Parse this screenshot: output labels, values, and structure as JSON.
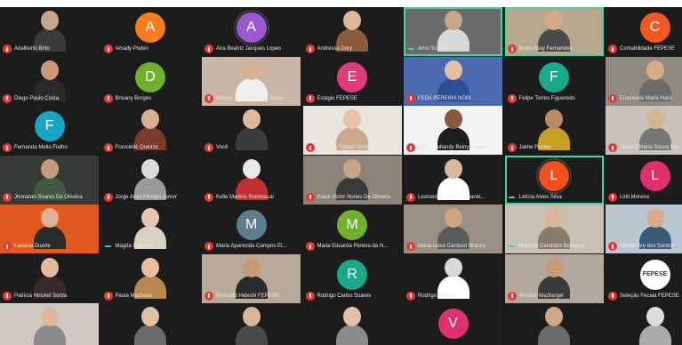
{
  "participants": [
    {
      "name": "Adalberto Brito",
      "kind": "video",
      "bg": "#1c1c1c",
      "skin": "#c8a48a",
      "shirt": "#3a3a3a",
      "mic": "muted"
    },
    {
      "name": "Amady Platen",
      "kind": "avatar",
      "initial": "A",
      "color": "#f57c1f",
      "mic": "muted"
    },
    {
      "name": "Ana Beatriz Jacques Lopes",
      "kind": "avatar",
      "initial": "A",
      "color": "#9b59d0",
      "mic": "muted",
      "ring": true
    },
    {
      "name": "Andressa Dary",
      "kind": "video",
      "bg": "#1c1c1c",
      "skin": "#e0b59a",
      "shirt": "#8a5a3a",
      "mic": "muted"
    },
    {
      "name": "Arno Schmitt",
      "kind": "video",
      "bg": "#6b6b6b",
      "skin": "#c9a58a",
      "shirt": "#d8d8d8",
      "mic": "on",
      "speaking": true
    },
    {
      "name": "Bruno Klay Fernandes",
      "kind": "video",
      "bg": "#b8a78f",
      "skin": "#d3a98a",
      "shirt": "#4a4a4a",
      "mic": "muted",
      "speaking": true
    },
    {
      "name": "Contabilidade FEPESE",
      "kind": "avatar",
      "initial": "C",
      "color": "#f2581f",
      "mic": "muted"
    },
    {
      "name": "Diego Paulo Costa",
      "kind": "video",
      "bg": "#1c1c1c",
      "skin": "#c89a7a",
      "shirt": "#2a2a2a",
      "mic": "muted"
    },
    {
      "name": "Brivany Borges",
      "kind": "avatar",
      "initial": "D",
      "color": "#6fb12c",
      "mic": "muted"
    },
    {
      "name": "Edlene Nunes Santos Souto",
      "kind": "video",
      "bg": "#c7b5a5",
      "skin": "#d8b094",
      "shirt": "#f0f0f0",
      "mic": "muted"
    },
    {
      "name": "Estagio FEPESE",
      "kind": "avatar",
      "initial": "E",
      "color": "#e33a7a",
      "mic": "muted"
    },
    {
      "name": "FEDA PEREIRA NÓBI",
      "kind": "video",
      "bg": "#4a6bb0",
      "skin": "#e3c0a3",
      "shirt": "#2d4f96",
      "mic": "muted"
    },
    {
      "name": "Felipe Torres Figueredo",
      "kind": "avatar",
      "initial": "F",
      "color": "#18a98b",
      "mic": "muted"
    },
    {
      "name": "Emanuela Maria Hans",
      "kind": "video",
      "bg": "#8f8a82",
      "skin": "#d6ab8c",
      "shirt": "#6d6d6d",
      "mic": "muted"
    },
    {
      "name": "Fernanda Mello Fialho",
      "kind": "avatar",
      "initial": "F",
      "color": "#1aa5c6",
      "mic": "muted"
    },
    {
      "name": "Franciélle Queiroz",
      "kind": "video",
      "bg": "#1c1c1c",
      "skin": "#d9b08f",
      "shirt": "#7a3b2b",
      "mic": "muted"
    },
    {
      "name": "Você",
      "kind": "video",
      "bg": "#1c1c1c",
      "skin": "#e0b99d",
      "shirt": "#3b3b3b",
      "mic": "muted"
    },
    {
      "name": "Gabriela Tagliari Martins",
      "kind": "video",
      "bg": "#e8e4de",
      "skin": "#e7c4a8",
      "shirt": "#c9a88c",
      "mic": "muted"
    },
    {
      "name": "Gleisy Tullandy Beiny Cordei...",
      "kind": "video",
      "bg": "#f3f3f3",
      "skin": "#8a5a3c",
      "shirt": "#1e1e1e",
      "mic": "muted"
    },
    {
      "name": "Jaime Pozian",
      "kind": "video",
      "bg": "#1c1c1c",
      "skin": "#b98a66",
      "shirt": "#c8a020",
      "mic": "muted"
    },
    {
      "name": "Jessica Maria Sousa Ro...",
      "kind": "video",
      "bg": "#c8c2ba",
      "skin": "#d8b092",
      "shirt": "#777777",
      "mic": "muted"
    },
    {
      "name": "Jhonatan Soares De Oliveira",
      "kind": "video",
      "bg": "#343a36",
      "skin": "#c59a7a",
      "shirt": "#3f5a3f",
      "mic": "muted"
    },
    {
      "name": "Jorge Aires Floriani Junior",
      "kind": "video",
      "bg": "#1c1c1c",
      "skin": "#d9dcdc",
      "shirt": "#9a9a9a",
      "mic": "muted"
    },
    {
      "name": "Kelle Martins Sommacal",
      "kind": "video",
      "bg": "#1c1c1c",
      "skin": "#e8e8e8",
      "shirt": "#c03030",
      "mic": "muted"
    },
    {
      "name": "Klaus Victor Nunes De Oliveira",
      "kind": "video",
      "bg": "#8c8478",
      "skin": "#c9a385",
      "shirt": "#3a3a3a",
      "mic": "muted"
    },
    {
      "name": "Leonardo Augusto Amante...",
      "kind": "video",
      "bg": "#1c1c1c",
      "skin": "#d7b89d",
      "shirt": "#ffffff",
      "mic": "muted"
    },
    {
      "name": "Letícia Alves Silva",
      "kind": "avatar",
      "initial": "L",
      "color": "#f2501e",
      "mic": "on",
      "speaking": true,
      "ring": true
    },
    {
      "name": "Liriti Moreira",
      "kind": "avatar",
      "initial": "L",
      "color": "#e0306f",
      "mic": "muted"
    },
    {
      "name": "Luciana Duarte",
      "kind": "video",
      "bg": "#e05a20",
      "skin": "#e0b094",
      "shirt": "#2a2a2a",
      "mic": "muted"
    },
    {
      "name": "Magda Degraaff",
      "kind": "video",
      "bg": "#1c1c1c",
      "skin": "#e6c6ad",
      "shirt": "#d9d0c2",
      "mic": "on"
    },
    {
      "name": "Maria Aparecida Campos El...",
      "kind": "avatar",
      "initial": "M",
      "color": "#607d8b",
      "mic": "muted"
    },
    {
      "name": "Maria Eduarda Pereira da N...",
      "kind": "avatar",
      "initial": "M",
      "color": "#6fb12c",
      "mic": "muted"
    },
    {
      "name": "Maria Luisa Cardoso Branco",
      "kind": "video",
      "bg": "#9a8f83",
      "skin": "#d3a384",
      "shirt": "#5a5a5a",
      "mic": "muted"
    },
    {
      "name": "Mariana Candolini Bonassa",
      "kind": "video",
      "bg": "#c9c0b4",
      "skin": "#dcb498",
      "shirt": "#8a7a6a",
      "mic": "on"
    },
    {
      "name": "Natalia Ary dos Santos",
      "kind": "video",
      "bg": "#b8c7d0",
      "skin": "#d8ab8d",
      "shirt": "#3a5a7a",
      "mic": "muted"
    },
    {
      "name": "Patricia Hinckel Sorda",
      "kind": "video",
      "bg": "#1c1c1c",
      "skin": "#e2b89c",
      "shirt": "#3a2a2a",
      "mic": "muted"
    },
    {
      "name": "Paula Machado",
      "kind": "video",
      "bg": "#1c1c1c",
      "skin": "#e6bf9e",
      "shirt": "#b8864e",
      "mic": "muted"
    },
    {
      "name": "Reinaldo Hideshi FEPESE",
      "kind": "video",
      "bg": "#b8aa98",
      "skin": "#c99876",
      "shirt": "#2a2a2a",
      "mic": "muted"
    },
    {
      "name": "Rodrigo Carlos Soares",
      "kind": "avatar",
      "initial": "R",
      "color": "#18a98b",
      "mic": "muted"
    },
    {
      "name": "Rodrigo Wilbert",
      "kind": "video",
      "bg": "#1c1c1c",
      "skin": "#d9d9d9",
      "shirt": "#ffffff",
      "mic": "muted"
    },
    {
      "name": "Simone Waztlargel",
      "kind": "video",
      "bg": "#b3a89b",
      "skin": "#c79a78",
      "shirt": "#3a3a3a",
      "mic": "muted"
    },
    {
      "name": "Seleção Fecaia FEPESE",
      "kind": "logo",
      "logo": "FEPESE",
      "color": "#ffffff",
      "mic": "muted"
    },
    {
      "name": "",
      "kind": "video",
      "bg": "#cfc9c1",
      "skin": "#e0b598",
      "shirt": "#8a8a8a",
      "mic": "none"
    },
    {
      "name": "",
      "kind": "video",
      "bg": "#1c1c1c",
      "skin": "#e2bea2",
      "shirt": "#6a6a6a",
      "mic": "none"
    },
    {
      "name": "",
      "kind": "video",
      "bg": "#1c1c1c",
      "skin": "#dbb597",
      "shirt": "#4a4a4a",
      "mic": "none"
    },
    {
      "name": "",
      "kind": "video",
      "bg": "#1c1c1c",
      "skin": "#e0c0a8",
      "shirt": "#8a8a8a",
      "mic": "none"
    },
    {
      "name": "",
      "kind": "avatar",
      "initial": "V",
      "color": "#e0306f",
      "mic": "none"
    },
    {
      "name": "",
      "kind": "video",
      "bg": "#1c1c1c",
      "skin": "#d0a888",
      "shirt": "#6a6a6a",
      "mic": "none"
    },
    {
      "name": "",
      "kind": "video",
      "bg": "#1c1c1c",
      "skin": "#dcdcdc",
      "shirt": "#aaaaaa",
      "mic": "none"
    }
  ]
}
